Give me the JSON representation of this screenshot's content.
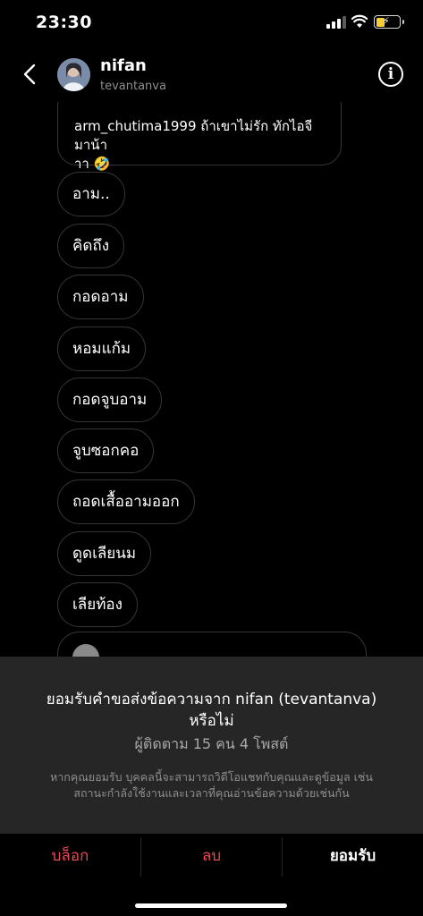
{
  "status": {
    "time": "23:30"
  },
  "header": {
    "name": "nifan",
    "username": "tevantanva",
    "info_glyph": "i"
  },
  "comment": {
    "username": "arm_chutima1999",
    "text": "ถ้าเขาไม่รัก ทักไอจีมาน้า",
    "text2": "าา 🤣"
  },
  "messages": [
    {
      "text": "อาม.."
    },
    {
      "text": "คิดถึง"
    },
    {
      "text": "กอดอาม"
    },
    {
      "text": "หอมแก้ม"
    },
    {
      "text": "กอดจูบอาม"
    },
    {
      "text": "จูบซอกคอ"
    },
    {
      "text": "ถอดเสื้ออามออก"
    },
    {
      "text": "ดูดเลียนม"
    },
    {
      "text": "เลียท้อง"
    }
  ],
  "request": {
    "title_line1": "ยอมรับคำขอส่งข้อความจาก nifan (tevantanva)",
    "title_line2": "หรือไม่",
    "stats": "ผู้ติดตาม 15 คน 4 โพสต์",
    "note_line1": "หากคุณยอมรับ บุคคลนี้จะสามารถวิดีโอแชทกับคุณและดูข้อมูล เช่น",
    "note_line2": "สถานะกำลังใช้งานและเวลาที่คุณอ่านข้อความด้วยเช่นกัน"
  },
  "actions": {
    "block": "บล็อก",
    "delete": "ลบ",
    "accept": "ยอมรับ"
  },
  "colors": {
    "danger": "#ed4956",
    "sheet_bg": "#262626",
    "bubble_border": "#363636",
    "muted": "#8e8e8e"
  },
  "icons": {
    "back": "chevron-left-icon",
    "info": "info-icon",
    "wifi": "wifi-icon",
    "battery": "battery-charging-icon",
    "signal": "signal-icon"
  }
}
